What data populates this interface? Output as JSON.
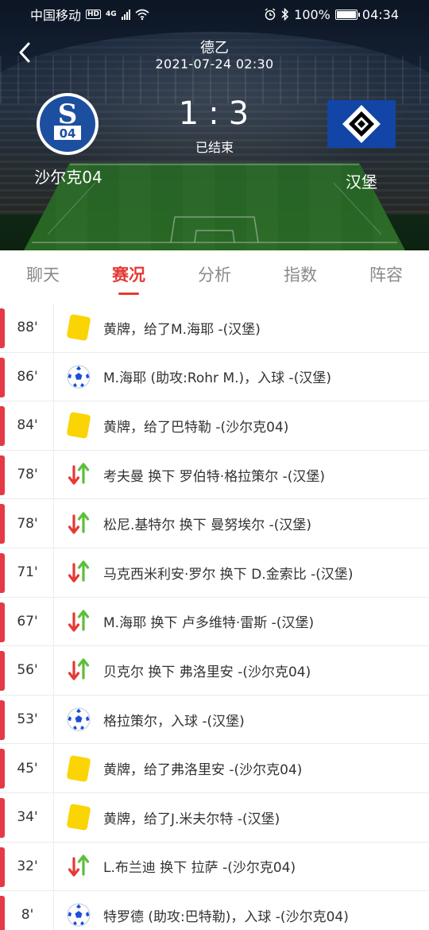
{
  "status_bar": {
    "carrier": "中国移动",
    "hd": "HD",
    "network": "4G",
    "battery": "100%",
    "time": "04:34"
  },
  "header": {
    "league": "德乙",
    "datetime": "2021-07-24 02:30",
    "home_team": "沙尔克04",
    "away_team": "汉堡",
    "home_score": "1",
    "away_score": "3",
    "score_separator": ":",
    "match_status": "已结束",
    "home_logo_text": "S04",
    "colors": {
      "home_blue": "#1d4fa0",
      "away_blue": "#1245a6"
    }
  },
  "tabs": [
    {
      "label": "聊天",
      "active": false
    },
    {
      "label": "赛况",
      "active": true
    },
    {
      "label": "分析",
      "active": false
    },
    {
      "label": "指数",
      "active": false
    },
    {
      "label": "阵容",
      "active": false
    }
  ],
  "events": [
    {
      "minute": "88'",
      "type": "yellow-card",
      "text": "黄牌，给了M.海耶 -(汉堡)"
    },
    {
      "minute": "86'",
      "type": "goal",
      "text": "M.海耶 (助攻:Rohr M.)，入球 -(汉堡)"
    },
    {
      "minute": "84'",
      "type": "yellow-card",
      "text": "黄牌，给了巴特勒 -(沙尔克04)"
    },
    {
      "minute": "78'",
      "type": "substitution",
      "text": "考夫曼 换下 罗伯特·格拉策尔 -(汉堡)"
    },
    {
      "minute": "78'",
      "type": "substitution",
      "text": "松尼.基特尔 换下 曼努埃尔 -(汉堡)"
    },
    {
      "minute": "71'",
      "type": "substitution",
      "text": "马克西米利安·罗尔 换下 D.金索比 -(汉堡)"
    },
    {
      "minute": "67'",
      "type": "substitution",
      "text": "M.海耶 换下 卢多维特·雷斯 -(汉堡)"
    },
    {
      "minute": "56'",
      "type": "substitution",
      "text": "贝克尔 换下 弗洛里安 -(沙尔克04)"
    },
    {
      "minute": "53'",
      "type": "goal",
      "text": "格拉策尔，入球 -(汉堡)"
    },
    {
      "minute": "45'",
      "type": "yellow-card",
      "text": "黄牌，给了弗洛里安 -(沙尔克04)"
    },
    {
      "minute": "34'",
      "type": "yellow-card",
      "text": "黄牌，给了J.米夫尔特 -(汉堡)"
    },
    {
      "minute": "32'",
      "type": "substitution",
      "text": "L.布兰迪 换下 拉萨 -(沙尔克04)"
    },
    {
      "minute": "8'",
      "type": "goal",
      "text": "特罗德 (助攻:巴特勒)，入球 -(沙尔克04)"
    }
  ],
  "accent_colors": {
    "active_tab": "#e53935",
    "event_marker": "#e53946",
    "yellow_card": "#fbd404",
    "sub_in": "#5cbf3a",
    "sub_out": "#e53935"
  }
}
